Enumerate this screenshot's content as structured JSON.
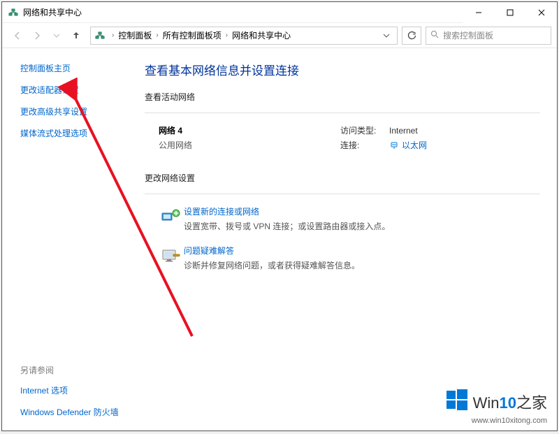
{
  "titlebar": {
    "title": "网络和共享中心"
  },
  "breadcrumb": {
    "p1": "控制面板",
    "p2": "所有控制面板项",
    "p3": "网络和共享中心"
  },
  "search": {
    "placeholder": "搜索控制面板"
  },
  "sidebar": {
    "home": "控制面板主页",
    "adapter": "更改适配器设置",
    "advanced": "更改高级共享设置",
    "media": "媒体流式处理选项",
    "seealso_label": "另请参阅",
    "internet_options": "Internet 选项",
    "firewall": "Windows Defender 防火墙"
  },
  "main": {
    "page_title": "查看基本网络信息并设置连接",
    "active_label": "查看活动网络",
    "net_name": "网络 4",
    "net_type": "公用网络",
    "access_key": "访问类型:",
    "access_val": "Internet",
    "conn_key": "连接:",
    "conn_val": "以太网",
    "change_label": "更改网络设置",
    "new_conn_link": "设置新的连接或网络",
    "new_conn_desc": "设置宽带、拨号或 VPN 连接；或设置路由器或接入点。",
    "trouble_link": "问题疑难解答",
    "trouble_desc": "诊断并修复网络问题，或者获得疑难解答信息。"
  },
  "watermark": {
    "brand_prefix": "Win",
    "brand_num": "10",
    "brand_suffix": "之家",
    "url": "www.win10xitong.com"
  }
}
